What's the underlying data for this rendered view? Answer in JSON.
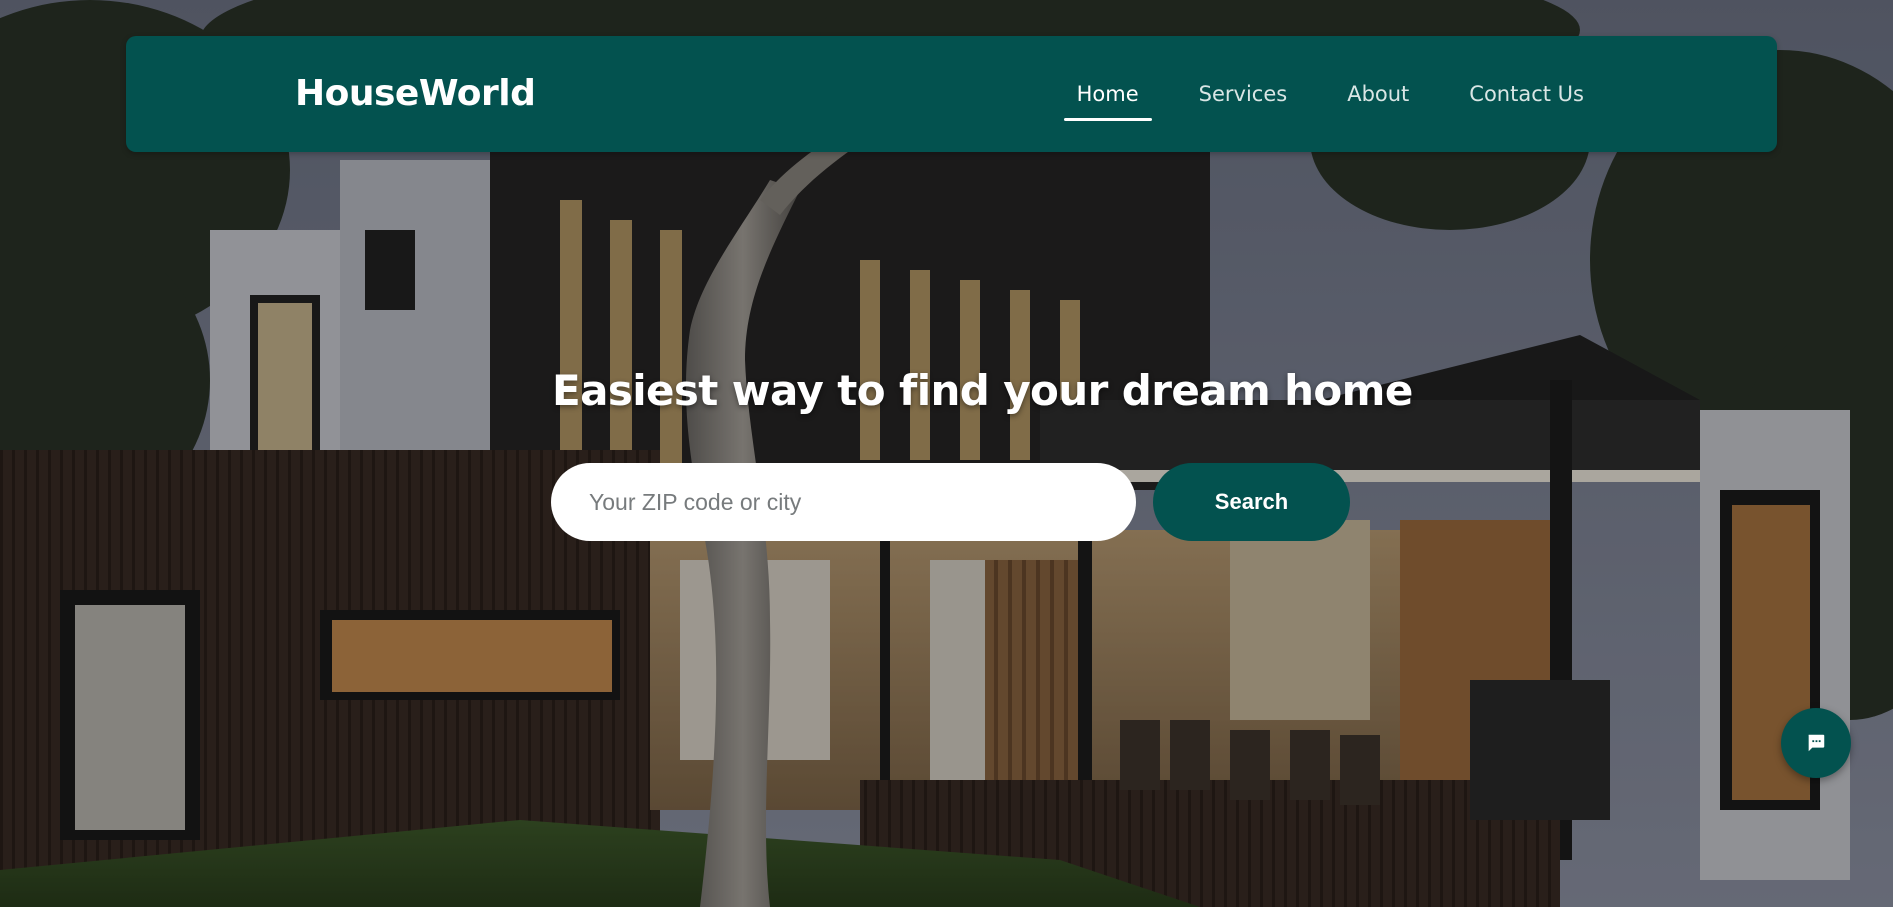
{
  "brand": {
    "name": "HouseWorld"
  },
  "nav": {
    "items": [
      {
        "label": "Home",
        "active": true
      },
      {
        "label": "Services",
        "active": false
      },
      {
        "label": "About",
        "active": false
      },
      {
        "label": "Contact Us",
        "active": false
      }
    ]
  },
  "hero": {
    "headline": "Easiest way to find your dream home",
    "search_placeholder": "Your ZIP code or city",
    "search_value": "",
    "search_button_label": "Search",
    "background_image": "modern-house-photo"
  },
  "chat": {
    "icon": "chat-bubble-icon"
  },
  "colors": {
    "primary": "#03524f",
    "text_light": "#ffffff",
    "input_bg": "#ffffff"
  }
}
